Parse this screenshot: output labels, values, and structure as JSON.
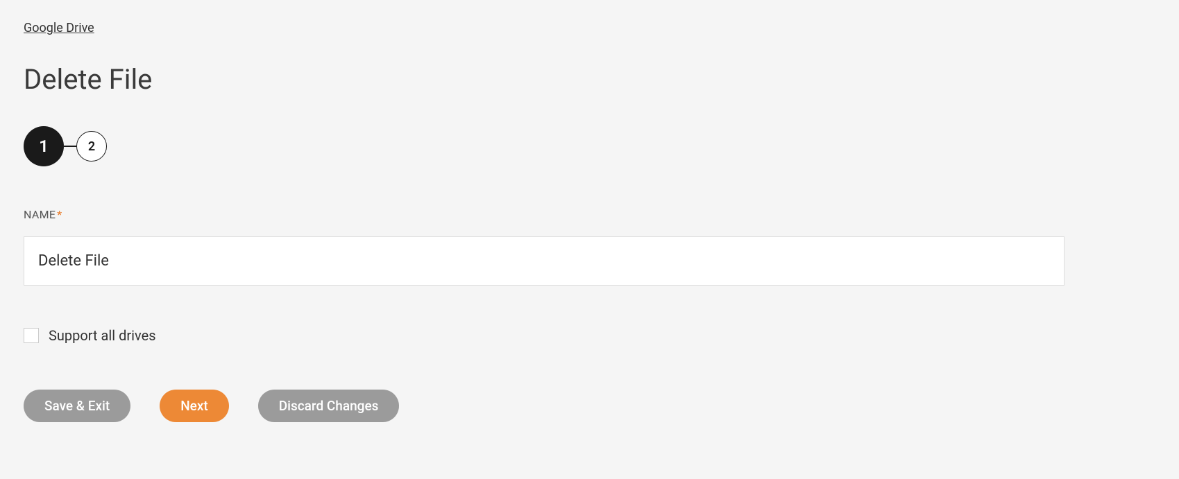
{
  "breadcrumb": {
    "label": "Google Drive"
  },
  "page": {
    "title": "Delete File"
  },
  "stepper": {
    "steps": [
      {
        "label": "1",
        "active": true
      },
      {
        "label": "2",
        "active": false
      }
    ]
  },
  "form": {
    "name_field": {
      "label": "NAME",
      "required_marker": "*",
      "value": "Delete File"
    },
    "support_drives": {
      "label": "Support all drives",
      "checked": false
    }
  },
  "buttons": {
    "save_exit": "Save & Exit",
    "next": "Next",
    "discard": "Discard Changes"
  }
}
